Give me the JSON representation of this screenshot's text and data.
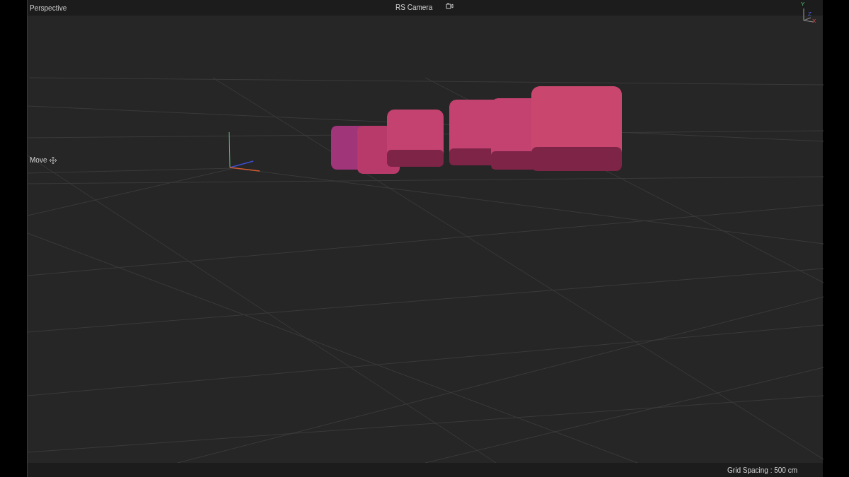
{
  "viewport": {
    "view_name": "Perspective",
    "camera": "RS Camera",
    "tool": "Move",
    "axis_labels": [
      "Y",
      "Z",
      "X"
    ],
    "status": "Grid Spacing : 500 cm"
  }
}
